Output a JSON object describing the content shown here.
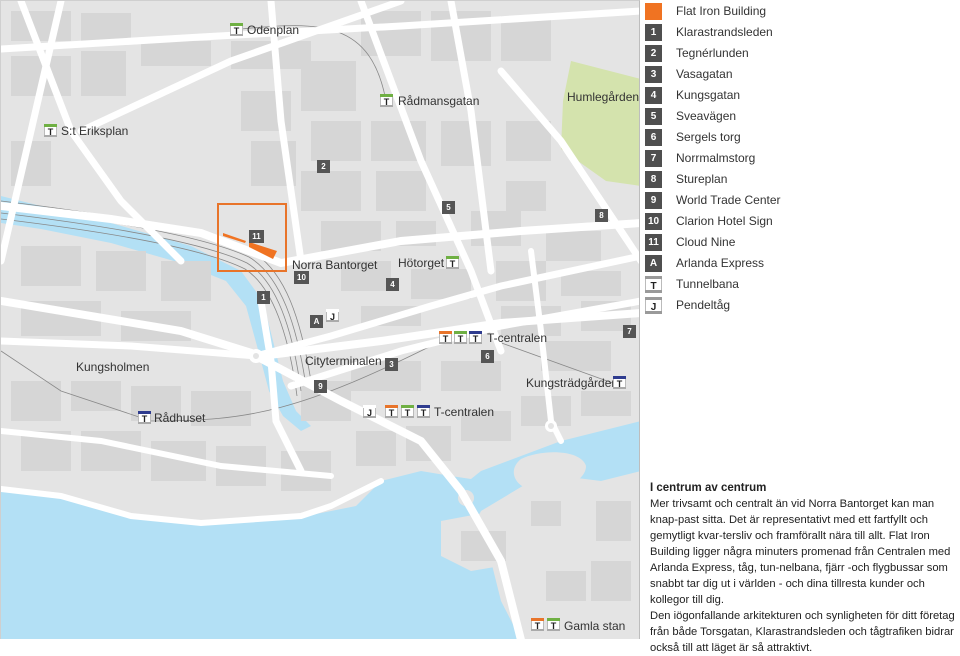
{
  "colors": {
    "land": "#e4e4e4",
    "block": "#d6d6d6",
    "road": "#ffffff",
    "water": "#b3e0f5",
    "park": "#d4e3ad",
    "marker": "#555555",
    "highlight": "#f07322",
    "line_green": "#6fb043",
    "line_red": "#e8742a",
    "line_blue": "#2f3c8f"
  },
  "map": {
    "places": {
      "odenplan": "Odenplan",
      "st_eriksplan": "S:t Eriksplan",
      "radmansgatan": "Rådmansgatan",
      "humlegarden": "Humlegården",
      "norra_bantorget": "Norra Bantorget",
      "hotorget": "Hötorget",
      "t_centralen_1": "T-centralen",
      "t_centralen_2": "T-centralen",
      "kungsholmen": "Kungsholmen",
      "cityterminalen": "Cityterminalen",
      "kungstradgarden": "Kungsträdgården",
      "radhuset": "Rådhuset",
      "gamla_stan": "Gamla stan"
    },
    "markers": [
      "1",
      "2",
      "3",
      "4",
      "5",
      "6",
      "7",
      "8",
      "9",
      "10",
      "11",
      "A",
      "J"
    ],
    "station_icon_letter": "T",
    "pendel_icon_letter": "J"
  },
  "legend": {
    "items": [
      {
        "key": "",
        "label": "Flat Iron Building",
        "type": "orange"
      },
      {
        "key": "1",
        "label": "Klarastrandsleden",
        "type": "num"
      },
      {
        "key": "2",
        "label": "Tegnérlunden",
        "type": "num"
      },
      {
        "key": "3",
        "label": "Vasagatan",
        "type": "num"
      },
      {
        "key": "4",
        "label": "Kungsgatan",
        "type": "num"
      },
      {
        "key": "5",
        "label": "Sveavägen",
        "type": "num"
      },
      {
        "key": "6",
        "label": "Sergels torg",
        "type": "num"
      },
      {
        "key": "7",
        "label": "Norrmalmstorg",
        "type": "num"
      },
      {
        "key": "8",
        "label": "Stureplan",
        "type": "num"
      },
      {
        "key": "9",
        "label": "World Trade Center",
        "type": "num"
      },
      {
        "key": "10",
        "label": "Clarion Hotel Sign",
        "type": "num"
      },
      {
        "key": "11",
        "label": "Cloud Nine",
        "type": "num"
      },
      {
        "key": "A",
        "label": "Arlanda Express",
        "type": "num"
      },
      {
        "key": "T",
        "label": "Tunnelbana",
        "type": "ticon"
      },
      {
        "key": "J",
        "label": "Pendeltåg",
        "type": "ticon"
      }
    ]
  },
  "info": {
    "title": "I centrum av centrum",
    "paragraph1": "Mer trivsamt och centralt än vid Norra Bantorget kan man knap-past sitta. Det är representativt med ett fartfyllt och gemytligt kvar-tersliv och framförallt nära till allt. Flat Iron Building ligger några minuters promenad från Centralen med Arlanda Express, tåg, tun-nelbana, fjärr -och flygbussar som snabbt tar dig ut i världen - och dina tillresta kunder och kollegor till dig.",
    "paragraph2": "Den iögonfallande arkitekturen och synligheten för ditt företag från både Torsgatan, Klarastrandsleden och tågtrafiken bidrar också till att läget är så attraktivt."
  }
}
